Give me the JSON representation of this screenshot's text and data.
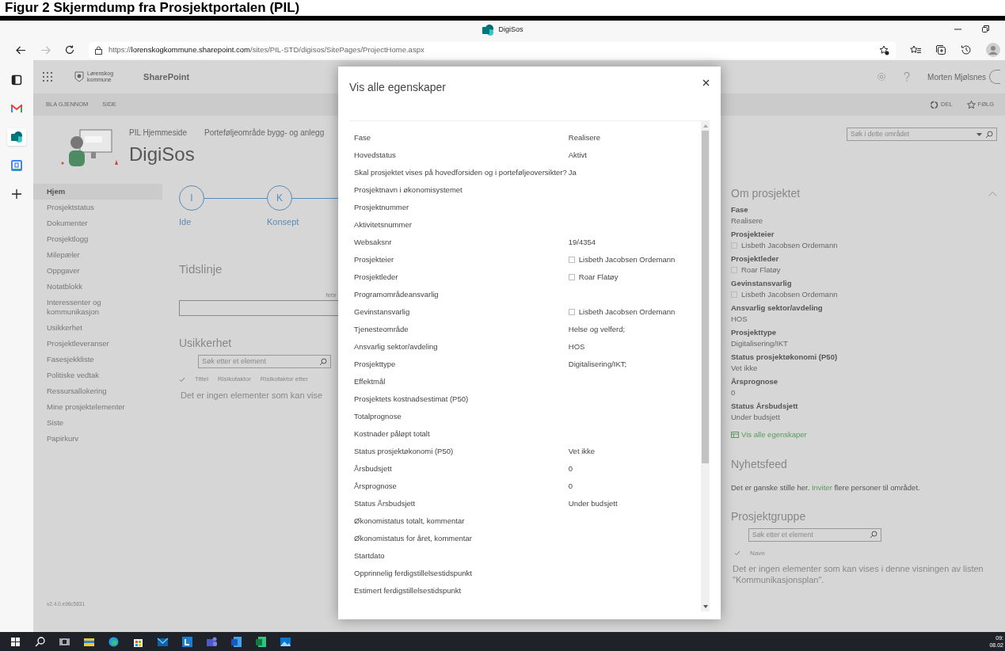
{
  "caption": "Figur 2 Skjermdump fra Prosjektportalen (PIL)",
  "browser": {
    "tab_title": "DigiSos",
    "url": {
      "scheme": "https://",
      "host": "lorenskogkommune.sharepoint.com",
      "path": "/sites/PIL-STD/digisos/SitePages/ProjectHome.aspx"
    },
    "sidebar": [
      {
        "kind": "tabs",
        "selected": false
      },
      {
        "kind": "mail",
        "selected": false
      },
      {
        "kind": "sharepoint",
        "selected": true
      },
      {
        "kind": "calendar",
        "selected": false
      },
      {
        "kind": "add",
        "selected": false
      }
    ]
  },
  "suite_bar": {
    "org_line_1": "Lørenskog",
    "org_line_2": "kommune",
    "app": "SharePoint",
    "user": "Morten Mjølsnes"
  },
  "ribbon": {
    "tabs": [
      "BLA GJENNOM",
      "SIDE"
    ],
    "actions": [
      {
        "kind": "share",
        "label": "DEL"
      },
      {
        "kind": "follow",
        "label": "FØLG"
      }
    ]
  },
  "header": {
    "breadcrumb": [
      "PIL Hjemmeside",
      "Porteføljeområde bygg- og anlegg"
    ],
    "site_title": "DigiSos",
    "search_placeholder": "Søk i dette området"
  },
  "nav": [
    {
      "label": "Hjem",
      "selected": true
    },
    {
      "label": "Prosjektstatus",
      "selected": false
    },
    {
      "label": "Dokumenter",
      "selected": false
    },
    {
      "label": "Prosjektlogg",
      "selected": false
    },
    {
      "label": "Milepæler",
      "selected": false
    },
    {
      "label": "Oppgaver",
      "selected": false
    },
    {
      "label": "Notatblokk",
      "selected": false
    },
    {
      "label": "Interessenter og kommunikasjon",
      "selected": false
    },
    {
      "label": "Usikkerhet",
      "selected": false
    },
    {
      "label": "Prosjektleveranser",
      "selected": false
    },
    {
      "label": "Fasesjekkliste",
      "selected": false
    },
    {
      "label": "Politiske vedtak",
      "selected": false
    },
    {
      "label": "Ressursallokering",
      "selected": false
    },
    {
      "label": "Mine prosjektelementer",
      "selected": false
    },
    {
      "label": "Siste",
      "selected": false
    },
    {
      "label": "Papirkurv",
      "selected": false
    }
  ],
  "version": "v2.4.0.e96c5831",
  "phases": [
    {
      "letter": "I",
      "label": "Ide"
    },
    {
      "letter": "K",
      "label": "Konsept"
    }
  ],
  "timeline": {
    "title": "Tidslinje",
    "month": "febr"
  },
  "risk": {
    "title": "Usikkerhet",
    "search_placeholder": "Søk etter et element",
    "columns": [
      "Tittel",
      "Risikofaktor",
      "Risikofaktor etter"
    ],
    "empty": "Det er ingen elementer som kan vise"
  },
  "about": {
    "title": "Om prosjektet",
    "fields": [
      {
        "label": "Fase",
        "value": "Realisere",
        "kind": "text"
      },
      {
        "label": "Prosjekteier",
        "value": "Lisbeth Jacobsen Ordemann",
        "kind": "person"
      },
      {
        "label": "Prosjektleder",
        "value": "Roar Flatøy",
        "kind": "person"
      },
      {
        "label": "Gevinstansvarlig",
        "value": "Lisbeth Jacobsen Ordemann",
        "kind": "person"
      },
      {
        "label": "Ansvarlig sektor/avdeling",
        "value": "HOS",
        "kind": "text"
      },
      {
        "label": "Prosjekttype",
        "value": "Digitalisering/IKT",
        "kind": "text"
      },
      {
        "label": "Status prosjektøkonomi (P50)",
        "value": "Vet ikke",
        "kind": "text"
      },
      {
        "label": "Årsprognose",
        "value": "0",
        "kind": "text"
      },
      {
        "label": "Status Årsbudsjett",
        "value": "Under budsjett",
        "kind": "text"
      }
    ],
    "link": "Vis alle egenskaper"
  },
  "news": {
    "title": "Nyhetsfeed",
    "before": "Det er ganske stille her.",
    "link": "Inviter",
    "after": "flere personer til området."
  },
  "group": {
    "title": "Prosjektgruppe",
    "search_placeholder": "Søk etter et element",
    "column": "Navn",
    "empty": "Det er ingen elementer som kan vises i denne visningen av listen \"Kommunikasjonsplan\"."
  },
  "modal": {
    "title": "Vis alle egenskaper",
    "rows": [
      {
        "label": "Fase",
        "value": "Realisere",
        "kind": "text"
      },
      {
        "label": "Hovedstatus",
        "value": "Aktivt",
        "kind": "text"
      },
      {
        "label": "Skal prosjektet vises på hovedforsiden og i porteføljeoversikter?",
        "value": "Ja",
        "kind": "text"
      },
      {
        "label": "Prosjektnavn i økonomisystemet",
        "kind": "empty"
      },
      {
        "label": "Prosjektnummer",
        "kind": "empty"
      },
      {
        "label": "Aktivitetsnummer",
        "kind": "empty"
      },
      {
        "label": "Websaksnr",
        "value": "19/4354",
        "kind": "text"
      },
      {
        "label": "Prosjekteier",
        "value": "Lisbeth Jacobsen Ordemann",
        "kind": "person"
      },
      {
        "label": "Prosjektleder",
        "value": "Roar Flatøy",
        "kind": "person"
      },
      {
        "label": "Programområdeansvarlig",
        "kind": "empty"
      },
      {
        "label": "Gevinstansvarlig",
        "value": "Lisbeth Jacobsen Ordemann",
        "kind": "person"
      },
      {
        "label": "Tjenesteområde",
        "value": "Helse og velferd;",
        "kind": "text"
      },
      {
        "label": "Ansvarlig sektor/avdeling",
        "value": "HOS",
        "kind": "text"
      },
      {
        "label": "Prosjekttype",
        "value": "Digitalisering/IKT;",
        "kind": "text"
      },
      {
        "label": "Effektmål",
        "kind": "empty"
      },
      {
        "label": "Prosjektets kostnadsestimat (P50)",
        "kind": "empty"
      },
      {
        "label": "Totalprognose",
        "kind": "empty"
      },
      {
        "label": "Kostnader påløpt totalt",
        "kind": "empty"
      },
      {
        "label": "Status prosjektøkonomi (P50)",
        "value": "Vet ikke",
        "kind": "text"
      },
      {
        "label": "Årsbudsjett",
        "value": "0",
        "kind": "text"
      },
      {
        "label": "Årsprognose",
        "value": "0",
        "kind": "text"
      },
      {
        "label": "Status Årsbudsjett",
        "value": "Under budsjett",
        "kind": "text"
      },
      {
        "label": "Økonomistatus totalt, kommentar",
        "kind": "empty"
      },
      {
        "label": "Økonomistatus for året, kommentar",
        "kind": "empty"
      },
      {
        "label": "Startdato",
        "kind": "empty"
      },
      {
        "label": "Opprinnelig ferdigstillelsestidspunkt",
        "kind": "empty"
      },
      {
        "label": "Estimert ferdigstillelsestidspunkt",
        "kind": "empty"
      }
    ]
  },
  "taskbar": {
    "clock_time": "09:",
    "clock_date": "08.02"
  }
}
